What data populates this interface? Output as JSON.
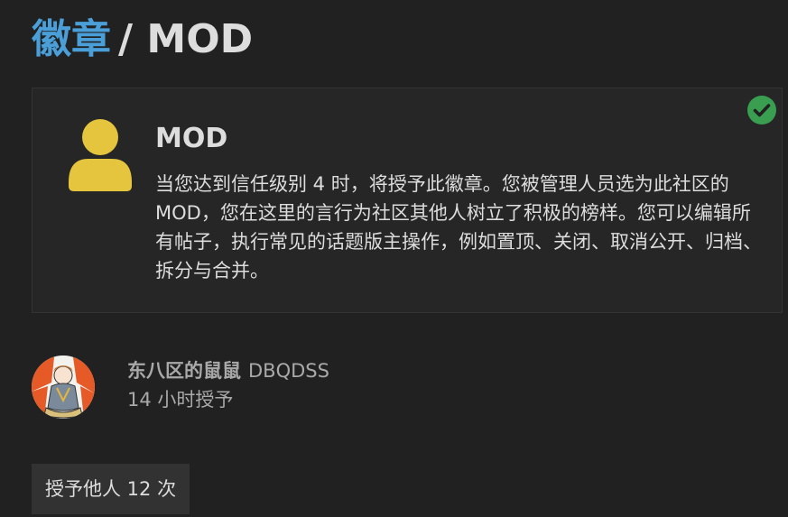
{
  "header": {
    "breadcrumb_link": "徽章",
    "separator": "/",
    "current": "MOD"
  },
  "badge": {
    "name": "MOD",
    "description": "当您达到信任级别 4 时，将授予此徽章。您被管理人员选为此社区的MOD，您在这里的言行为社区其他人树立了积极的榜样。您可以编辑所有帖子，执行常见的话题版主操作，例如置顶、关闭、取消公开、归档、拆分与合并。",
    "icon": "user-icon",
    "icon_color": "#e4c53d",
    "granted": true,
    "granted_icon": "check-circle-icon",
    "granted_color": "#3a9e51"
  },
  "grant": {
    "username": "东八区的鼠鼠",
    "handle": "DBQDSS",
    "time": "14 小时授予",
    "avatar": "avatar"
  },
  "others_button": {
    "label": "授予他人 12 次"
  },
  "colors": {
    "background": "#212121",
    "card": "#262626",
    "link": "#4a9fd8",
    "text": "#dddddd",
    "muted": "#a9a9a9"
  }
}
